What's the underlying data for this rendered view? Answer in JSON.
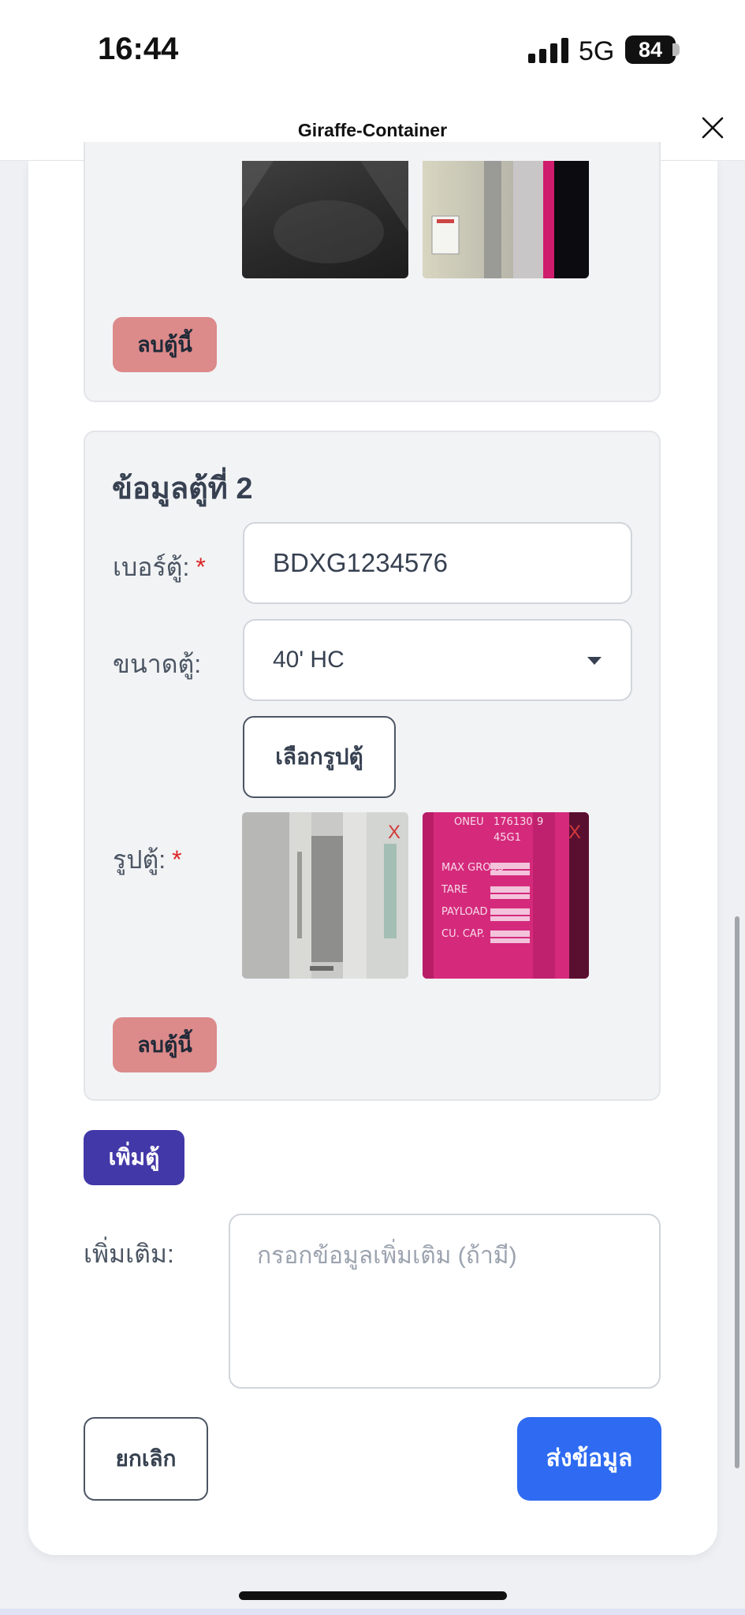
{
  "status_bar": {
    "time": "16:44",
    "network": "5G",
    "battery": "84"
  },
  "header": {
    "title": "Giraffe-Container"
  },
  "container_1": {
    "delete_label": "ลบตู้นี้"
  },
  "container_2": {
    "title": "ข้อมูลตู้ที่ 2",
    "number_label": "เบอร์ตู้:",
    "number_value": "BDXG1234576",
    "size_label": "ขนาดตู้:",
    "size_value": "40' HC",
    "choose_photo_label": "เลือกรูปตู้",
    "photo_label": "รูปตู้:",
    "remove_mark": "X",
    "delete_label": "ลบตู้นี้"
  },
  "required_mark": "*",
  "add_container_label": "เพิ่มตู้",
  "extra": {
    "label": "เพิ่มเติม:",
    "placeholder": "กรอกข้อมูลเพิ่มเติม (ถ้ามี)"
  },
  "actions": {
    "cancel_label": "ยกเลิก",
    "submit_label": "ส่งข้อมูล"
  },
  "colors": {
    "primary": "#2f6bf2",
    "add": "#4338a8",
    "delete": "#dc8a8a",
    "required": "#dc2626"
  }
}
